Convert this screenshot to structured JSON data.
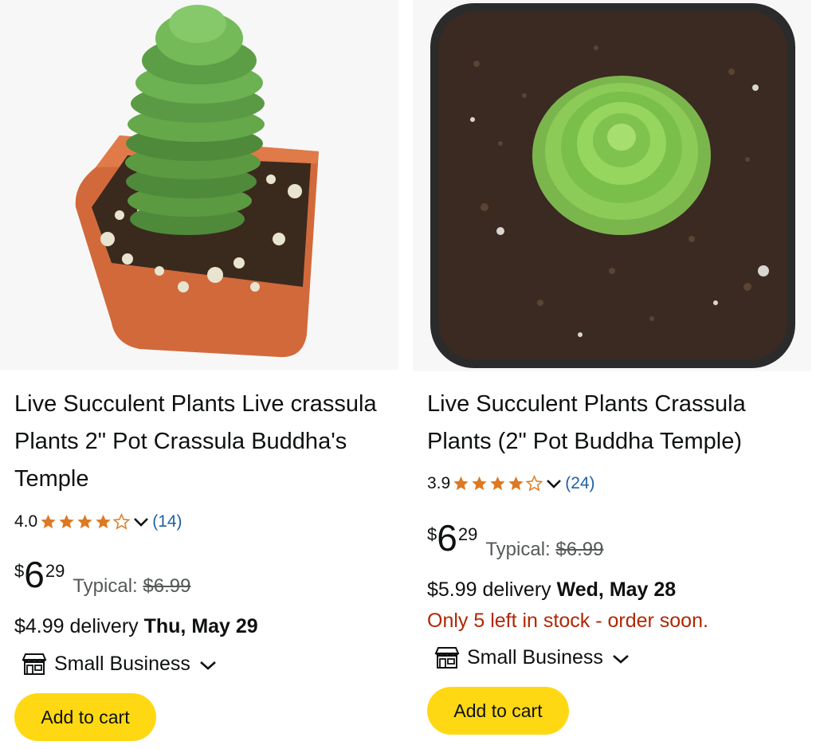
{
  "products": [
    {
      "title": "Live Succulent Plants Live crassula Plants 2\" Pot Crassula Buddha's Temple",
      "rating": "4.0",
      "stars_value": 4.0,
      "review_count": "(14)",
      "price": {
        "currency": "$",
        "whole": "6",
        "fraction": "29"
      },
      "typical_label": "Typical:",
      "typical_price": "$6.99",
      "delivery_prefix": "$4.99 delivery",
      "delivery_date": "Thu, May 29",
      "stock_note": "",
      "badge": "Small Business",
      "cart_label": "Add to cart",
      "image_icon": "succulent-orange-pot"
    },
    {
      "title": "Live Succulent Plants Crassula Plants (2\" Pot Buddha Temple)",
      "rating": "3.9",
      "stars_value": 3.9,
      "review_count": "(24)",
      "price": {
        "currency": "$",
        "whole": "6",
        "fraction": "29"
      },
      "typical_label": "Typical:",
      "typical_price": "$6.99",
      "delivery_prefix": "$5.99 delivery",
      "delivery_date": "Wed, May 28",
      "stock_note": "Only 5 left in stock - order soon.",
      "badge": "Small Business",
      "cart_label": "Add to cart",
      "image_icon": "succulent-black-pot-top-view"
    }
  ],
  "colors": {
    "star": "#de7921",
    "link": "#2162a1",
    "cart": "#ffd814",
    "stock": "#b12704",
    "muted": "#565959"
  }
}
